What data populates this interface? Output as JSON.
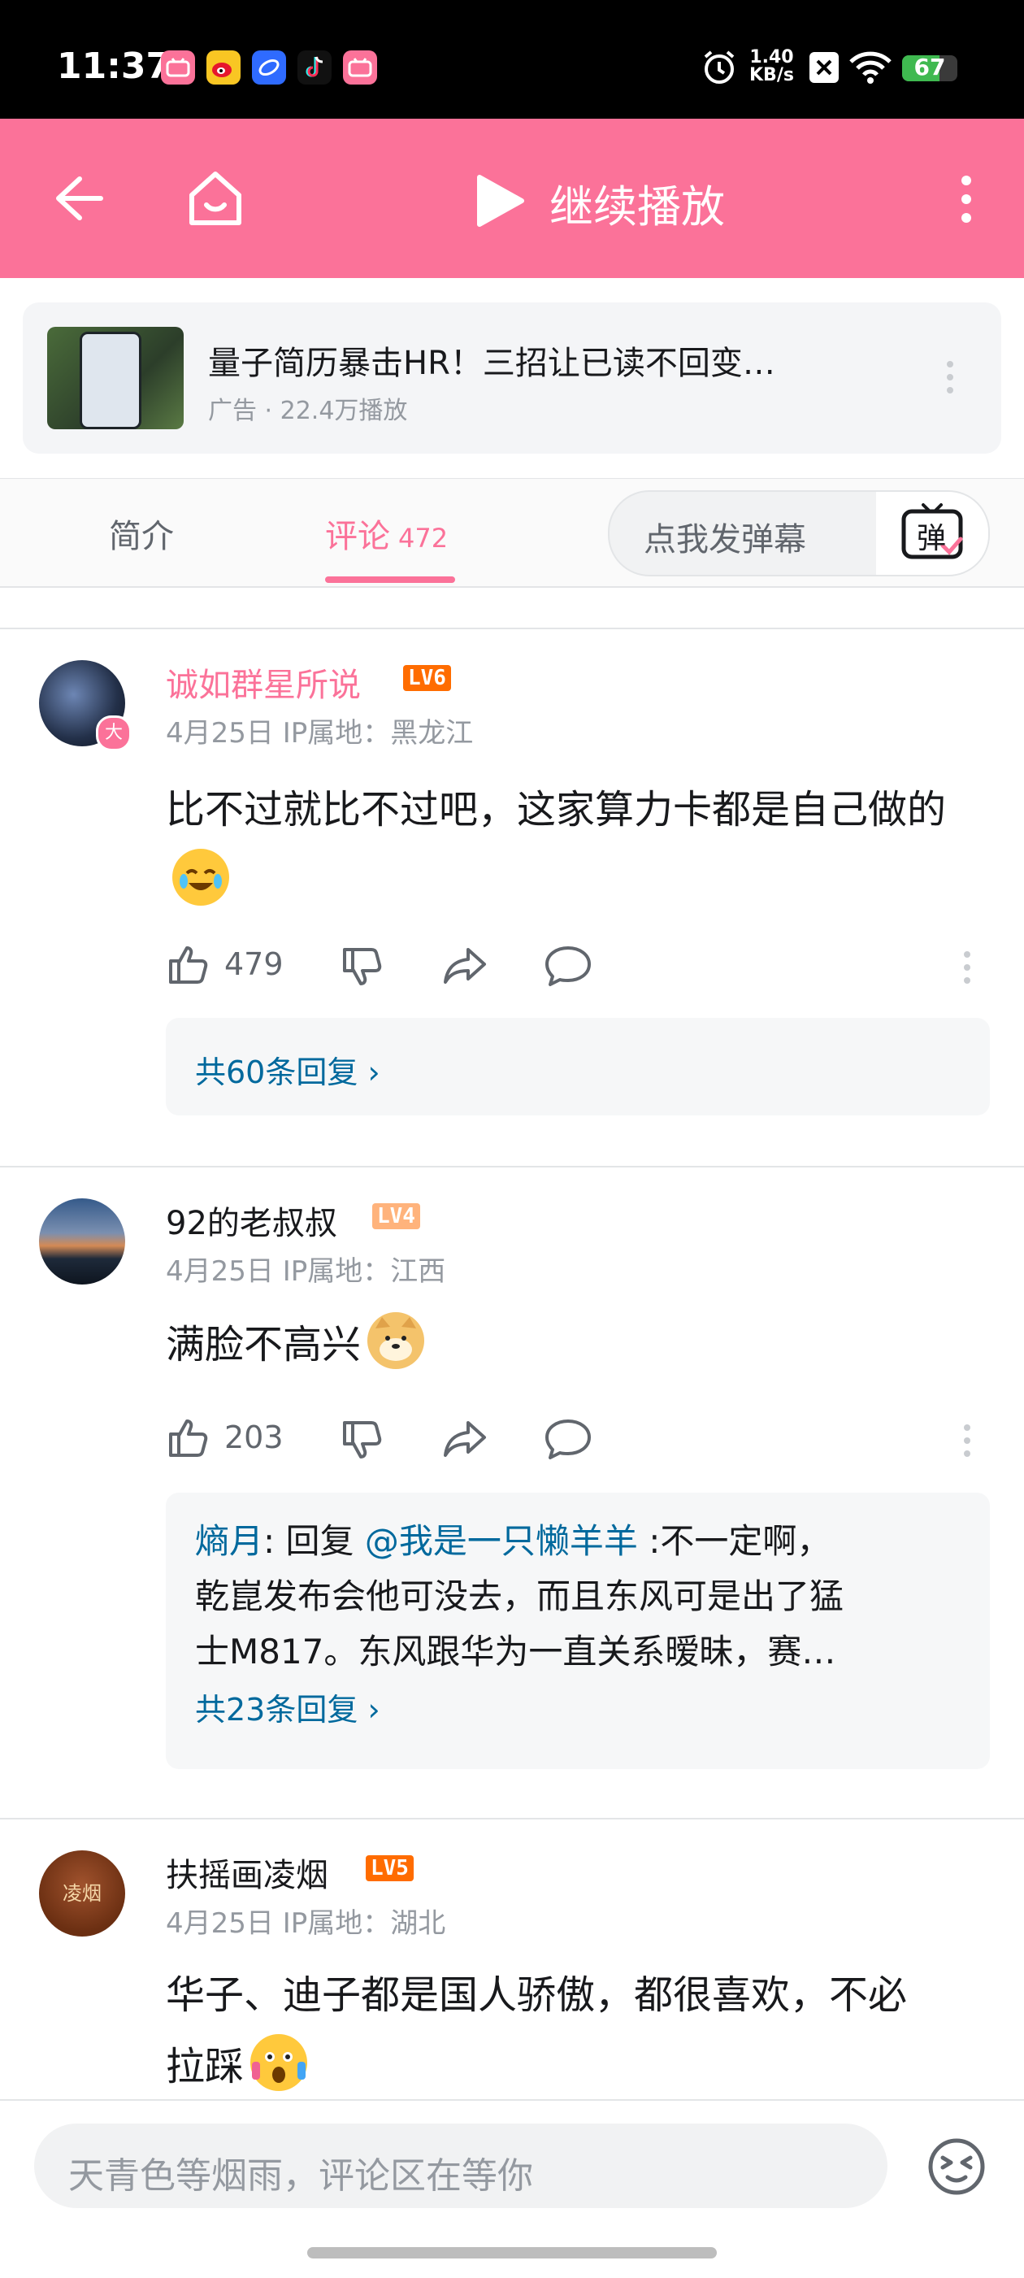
{
  "status_bar": {
    "time": "11:37",
    "speed_value": "1.40",
    "speed_unit": "KB/s",
    "battery": 67,
    "battery_label": "67",
    "app_icons": [
      "bilibili-icon",
      "weibo-icon",
      "browser-icon",
      "tiktok-icon",
      "bilibili-icon"
    ]
  },
  "nav": {
    "continue_label": "继续播放"
  },
  "ad": {
    "title": "量子简历暴击HR！三招让已读不回变…",
    "meta": "广告 · 22.4万播放"
  },
  "tabs": {
    "intro": "简介",
    "comments": "评论",
    "comments_count": "472",
    "danmaku_placeholder": "点我发弹幕",
    "danmaku_icon_char": "弹"
  },
  "comments": [
    {
      "user": "诚如群星所说",
      "level": "LV6",
      "level_color": "#ff6c00",
      "avatar_badge": "大",
      "meta": "4月25日 IP属地：黑龙江",
      "text": "比不过就比不过吧，这家算力卡都是自己做的",
      "emoji": "laugh-cry-emoji",
      "likes": "479",
      "reply_count_text": "共60条回复"
    },
    {
      "user": "92的老叔叔",
      "level": "LV4",
      "level_color": "#ffb37c",
      "meta": "4月25日 IP属地：江西",
      "text": "满脸不高兴",
      "emoji": "doge-emoji",
      "likes": "203",
      "reply": {
        "user": "熵月",
        "reply_word": "回复",
        "mention": "@我是一只懒羊羊",
        "text_line1": ":不一定啊，",
        "text_line2": "乾崑发布会他可没去，而且东风可是出了猛",
        "text_line3": "士M817。东风跟华为一直关系暧昧，赛…"
      },
      "reply_count_text": "共23条回复"
    },
    {
      "user": "扶摇画凌烟",
      "level": "LV5",
      "level_color": "#ff6c00",
      "avatar_text": "凌烟",
      "meta": "4月25日 IP属地：湖北",
      "text_line1": "华子、迪子都是国人骄傲，都很喜欢，不必",
      "text_line2": "拉踩",
      "emoji": "shocked-emoji"
    }
  ],
  "bottom_bar": {
    "input_placeholder": "天青色等烟雨，评论区在等你"
  },
  "colors": {
    "accent": "#fb7299",
    "link": "#00699d",
    "muted": "#9499a0"
  }
}
